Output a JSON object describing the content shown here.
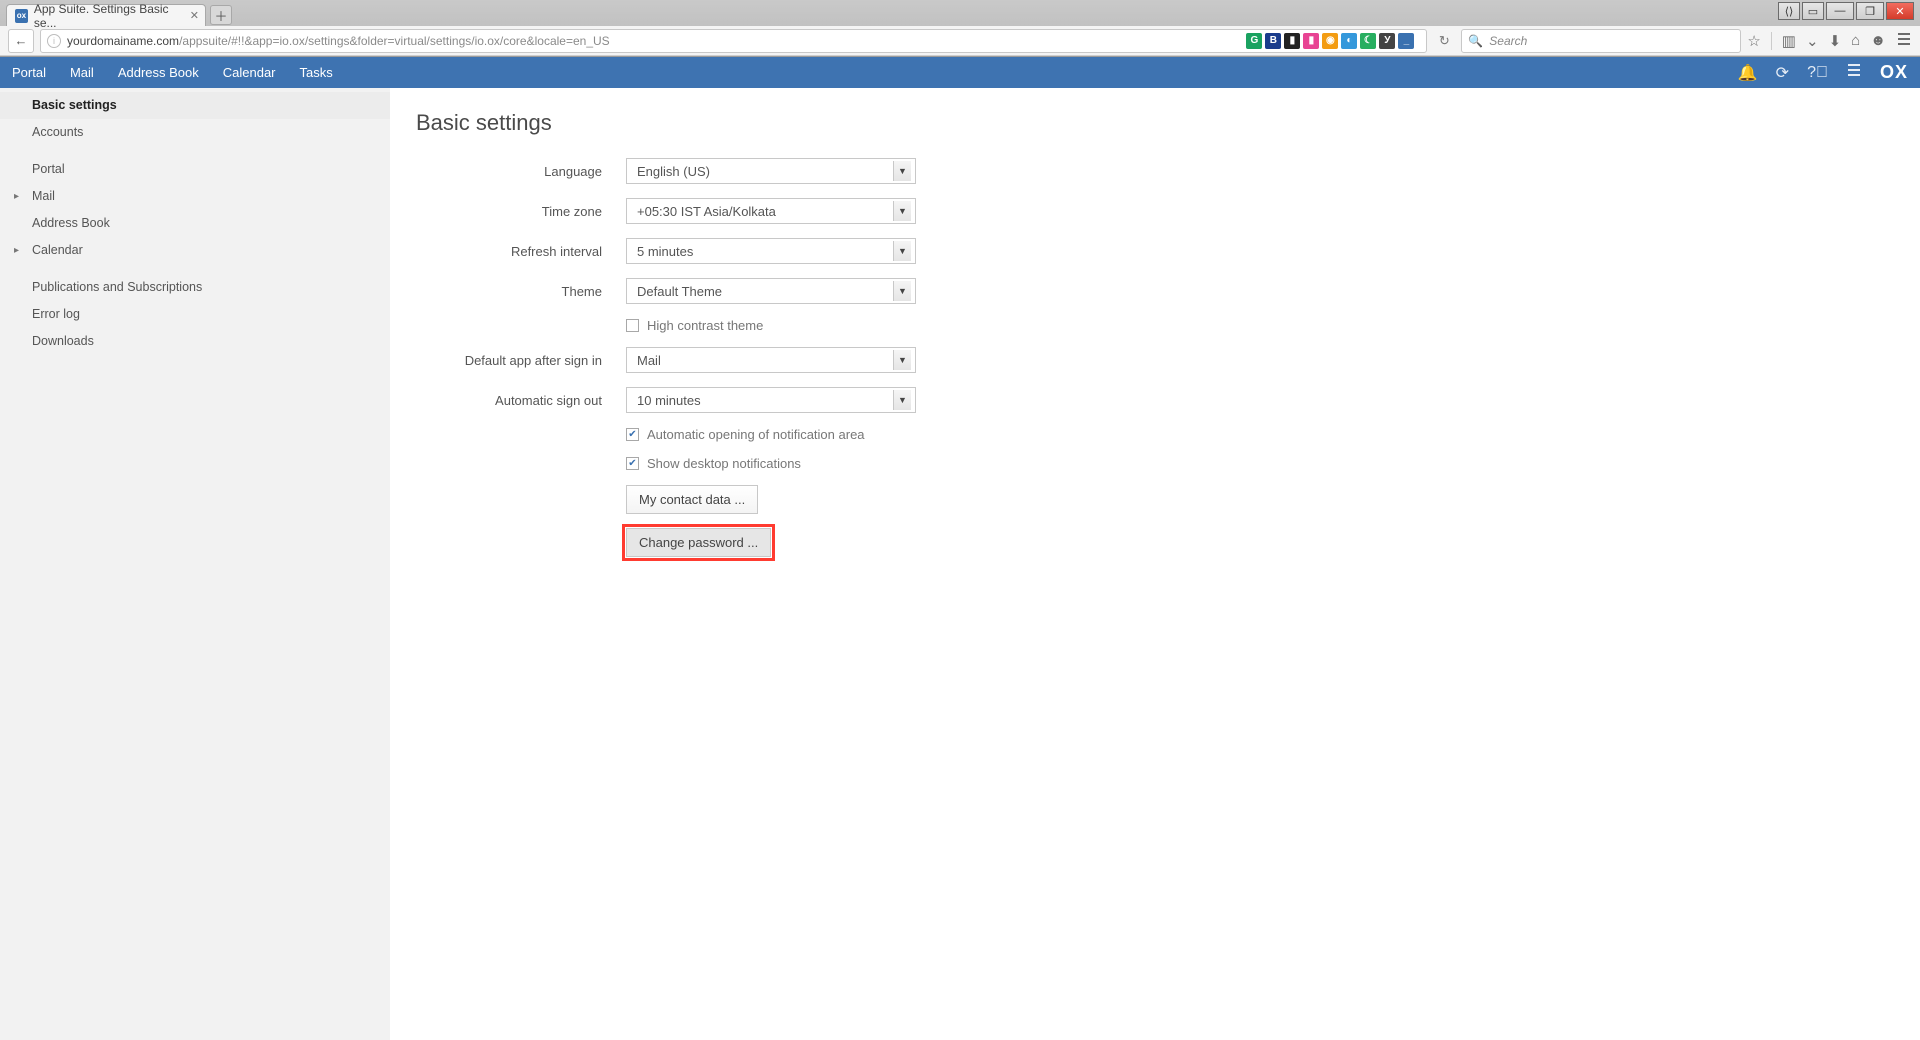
{
  "browser": {
    "tab_title": "App Suite. Settings Basic se...",
    "url_domain": "yourdomainame.com",
    "url_path": "/appsuite/#!!&app=io.ox/settings&folder=virtual/settings/io.ox/core&locale=en_US",
    "search_placeholder": "Search",
    "extensions": [
      {
        "label": "G",
        "color": "#1aa260"
      },
      {
        "label": "B",
        "color": "#1a3c8c"
      },
      {
        "label": "▮",
        "color": "#222"
      },
      {
        "label": "▮",
        "color": "#e84393"
      },
      {
        "label": "◉",
        "color": "#f39c12"
      },
      {
        "label": "◐",
        "color": "#3498db"
      },
      {
        "label": "☾",
        "color": "#27ae60"
      },
      {
        "label": "У",
        "color": "#444"
      },
      {
        "label": "_",
        "color": "#3a71b0"
      }
    ]
  },
  "appbar": {
    "nav": [
      "Portal",
      "Mail",
      "Address Book",
      "Calendar",
      "Tasks"
    ],
    "logo": "OX"
  },
  "sidebar": {
    "items": [
      {
        "label": "Basic settings",
        "bold": true,
        "caret": false
      },
      {
        "label": "Accounts",
        "bold": false,
        "caret": false
      },
      {
        "gap": true
      },
      {
        "label": "Portal",
        "bold": false,
        "caret": false
      },
      {
        "label": "Mail",
        "bold": false,
        "caret": true
      },
      {
        "label": "Address Book",
        "bold": false,
        "caret": false
      },
      {
        "label": "Calendar",
        "bold": false,
        "caret": true
      },
      {
        "gap": true
      },
      {
        "label": "Publications and Subscriptions",
        "bold": false,
        "caret": false
      },
      {
        "label": "Error log",
        "bold": false,
        "caret": false
      },
      {
        "label": "Downloads",
        "bold": false,
        "caret": false
      }
    ]
  },
  "settings": {
    "heading": "Basic settings",
    "labels": {
      "language": "Language",
      "timezone": "Time zone",
      "refresh": "Refresh interval",
      "theme": "Theme",
      "default_app": "Default app after sign in",
      "auto_signout": "Automatic sign out"
    },
    "values": {
      "language": "English (US)",
      "timezone": "+05:30 IST Asia/Kolkata",
      "refresh": "5 minutes",
      "theme": "Default Theme",
      "default_app": "Mail",
      "auto_signout": "10 minutes"
    },
    "checkboxes": {
      "high_contrast": {
        "label": "High contrast theme",
        "checked": false
      },
      "auto_notif": {
        "label": "Automatic opening of notification area",
        "checked": true
      },
      "desktop_notif": {
        "label": "Show desktop notifications",
        "checked": true
      }
    },
    "buttons": {
      "contact": "My contact data ...",
      "password": "Change password ..."
    }
  }
}
